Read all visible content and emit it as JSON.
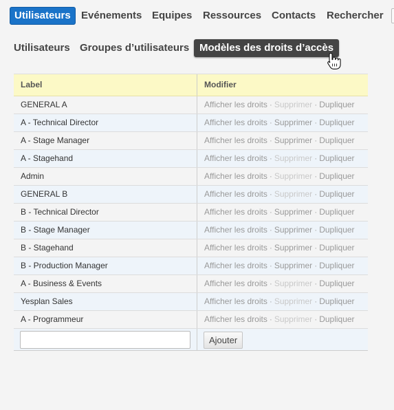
{
  "topnav": {
    "items": [
      {
        "label": "Utilisateurs",
        "active": true
      },
      {
        "label": "Evénements"
      },
      {
        "label": "Equipes"
      },
      {
        "label": "Ressources"
      },
      {
        "label": "Contacts"
      },
      {
        "label": "Rechercher"
      }
    ]
  },
  "subnav": {
    "items": [
      {
        "label": "Utilisateurs"
      },
      {
        "label": "Groupes d’utilisateurs"
      },
      {
        "label": "Modèles des droits d’accès",
        "active": true
      }
    ]
  },
  "table": {
    "headers": {
      "label": "Label",
      "modify": "Modifier"
    },
    "actions": {
      "view": "Afficher les droits",
      "delete": "Supprimer",
      "duplicate": "Dupliquer",
      "sep": "·"
    },
    "rows": [
      {
        "label": "GENERAL A",
        "delete_enabled": false
      },
      {
        "label": "A - Technical Director",
        "delete_enabled": true
      },
      {
        "label": "A - Stage Manager",
        "delete_enabled": true
      },
      {
        "label": "A - Stagehand",
        "delete_enabled": false
      },
      {
        "label": "Admin",
        "delete_enabled": false
      },
      {
        "label": "GENERAL B",
        "delete_enabled": false
      },
      {
        "label": "B - Technical Director",
        "delete_enabled": true
      },
      {
        "label": "B - Stage Manager",
        "delete_enabled": true
      },
      {
        "label": "B - Stagehand",
        "delete_enabled": true
      },
      {
        "label": "B - Production Manager",
        "delete_enabled": true
      },
      {
        "label": "A - Business & Events",
        "delete_enabled": false
      },
      {
        "label": "Yesplan Sales",
        "delete_enabled": false
      },
      {
        "label": "A - Programmeur",
        "delete_enabled": false
      }
    ],
    "new_row": {
      "input_value": "",
      "add_button": "Ajouter"
    }
  },
  "colors": {
    "accent": "#1a73c8",
    "header_bg": "#fcf9c6",
    "active_sub": "#444444"
  }
}
